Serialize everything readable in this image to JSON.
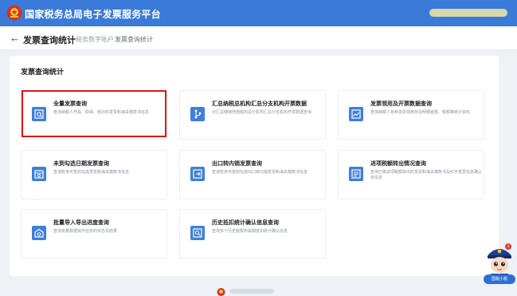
{
  "header": {
    "app_title": "国家税务总局电子发票服务平台"
  },
  "subheader": {
    "back_icon": "←",
    "page_title": "发票查询统计",
    "breadcrumb": [
      "税务数字账户",
      "发票查询统计"
    ],
    "separator": "›"
  },
  "section": {
    "title": "发票查询统计"
  },
  "cards": [
    {
      "title": "全量发票查询",
      "desc": "查询纳税人开具、取得、经办的发票和海关缴款书信息",
      "icon": "search-document-icon"
    },
    {
      "title": "汇总纳税总机构汇总分支机构开票数据",
      "desc": "对汇总缴纳增值税的总分机构汇总分支机构开票数据查询",
      "icon": "branch-icon"
    },
    {
      "title": "发票领用及开票数据查询",
      "desc": "查询纳税人各种发票领用存及明细金额、税额等统计资料",
      "icon": "chart-icon"
    },
    {
      "title": "未到勾选日期发票查询",
      "desc": "查询暂未可抵扣勾选发票和海关缴款书信息",
      "icon": "calendar-check-icon"
    },
    {
      "title": "出口转内销发票查询",
      "desc": "查询暂未可抵扣勾选出口转内销发票和海关缴款书信息",
      "icon": "export-icon"
    },
    {
      "title": "进项税额转出情况查询",
      "desc": "查询已做进项税额转出的发票和海关缴款书及红字发票信息确认单信息",
      "icon": "list-icon"
    },
    {
      "title": "批量导入导出进度查询",
      "desc": "查询批量数据操作任务的状态及结果",
      "icon": "import-export-icon"
    },
    {
      "title": "历史抵扣统计确认信息查询",
      "desc": "查询多个历史税款所属期抵扣统计确认信息",
      "icon": "history-icon"
    }
  ],
  "assistant": {
    "badge": "国税小税",
    "chat_count": "1"
  },
  "colors": {
    "header_bg": "#3a7ad8",
    "icon_bg": "#3f7fdb",
    "highlight": "#e0141a"
  }
}
